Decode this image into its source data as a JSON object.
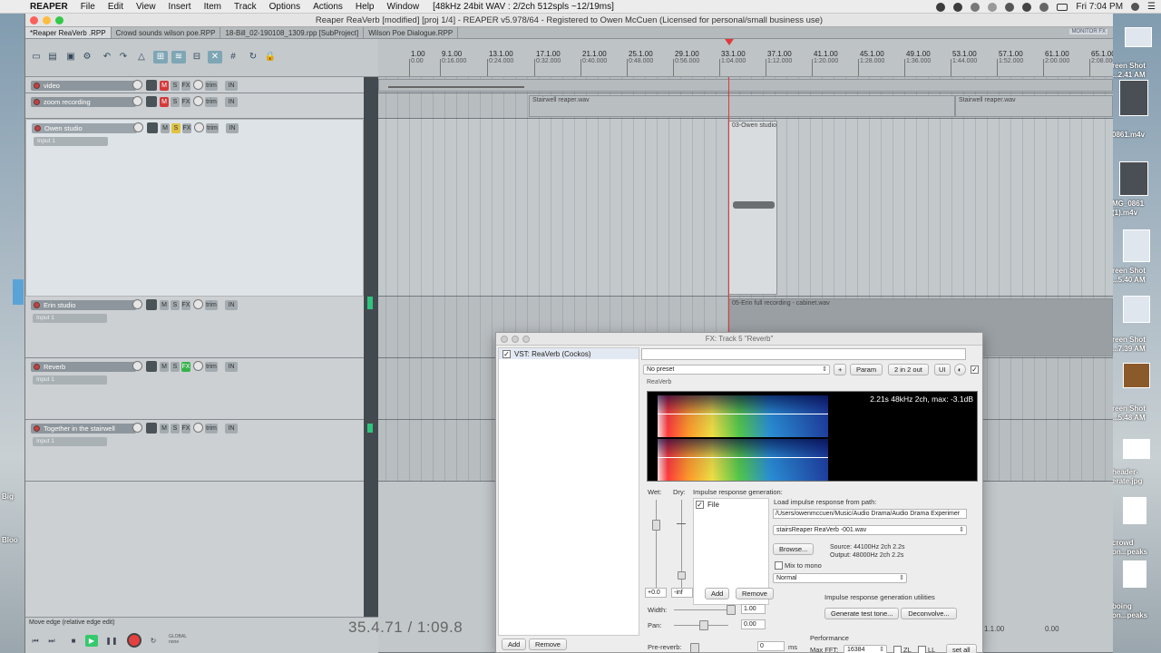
{
  "menubar": {
    "app": "REAPER",
    "items": [
      "File",
      "Edit",
      "View",
      "Insert",
      "Item",
      "Track",
      "Options",
      "Actions",
      "Help",
      "Window"
    ],
    "info": "[48kHz 24bit WAV : 2/2ch 512spls ~12/19ms]",
    "clock": "Fri 7:04 PM"
  },
  "window": {
    "title": "Reaper ReaVerb [modified] [proj 1/4] - REAPER v5.978/64 - Registered to Owen McCuen (Licensed for personal/small business use)",
    "tabs": [
      "*Reaper ReaVerb .RPP",
      "Crowd sounds wilson poe.RPP",
      "18-Bill_02-190108_1309.rpp [SubProject]",
      "Wilson Poe Dialogue.RPP"
    ],
    "monitor_tag": "MONITOR FX"
  },
  "ruler": {
    "ticks": [
      {
        "m": "1.00",
        "s": "0.00"
      },
      {
        "m": "9.1.00",
        "s": "0:16.000"
      },
      {
        "m": "13.1.00",
        "s": "0:24.000"
      },
      {
        "m": "17.1.00",
        "s": "0:32.000"
      },
      {
        "m": "21.1.00",
        "s": "0:40.000"
      },
      {
        "m": "25.1.00",
        "s": "0:48.000"
      },
      {
        "m": "29.1.00",
        "s": "0:56.000"
      },
      {
        "m": "33.1.00",
        "s": "1:04.000"
      },
      {
        "m": "37.1.00",
        "s": "1:12.000"
      },
      {
        "m": "41.1.00",
        "s": "1:20.000"
      },
      {
        "m": "45.1.00",
        "s": "1:28.000"
      },
      {
        "m": "49.1.00",
        "s": "1:36.000"
      },
      {
        "m": "53.1.00",
        "s": "1:44.000"
      },
      {
        "m": "57.1.00",
        "s": "1:52.000"
      },
      {
        "m": "61.1.00",
        "s": "2:00.000"
      },
      {
        "m": "65.1.00",
        "s": "2:08.000"
      }
    ]
  },
  "tracks": [
    {
      "name": "video",
      "input": ""
    },
    {
      "name": "zoom recording",
      "input": ""
    },
    {
      "name": "Owen studio",
      "input": "Input 1"
    },
    {
      "name": "Erin studio",
      "input": "Input 1"
    },
    {
      "name": "Reverb",
      "input": "Input 1"
    },
    {
      "name": "Together in the stairwell",
      "input": "Input 1"
    }
  ],
  "track_buttons": {
    "mute": "M",
    "solo": "S",
    "fx": "FX",
    "io": "trim",
    "rec_mon": "IN"
  },
  "items": {
    "stairwell_a": "Stairwell reaper.wav",
    "stairwell_b": "Stairwell reaper.wav",
    "owen_clip": "03-Owen studio",
    "erin_clip": "05-Erin full recording - cabinet.wav"
  },
  "transport": {
    "status": "Move edge (relative edge edit)",
    "global": "GLOBAL",
    "global_sub": "none",
    "timecode": "35.4.71 / 1:09.8",
    "bpm": "1.1.00",
    "rate": "0.00"
  },
  "fx": {
    "title": "FX: Track 5 \"Reverb\"",
    "plugin": "VST: ReaVerb (Cockos)",
    "preset": "No preset",
    "plus": "+",
    "param": "Param",
    "io": "2 in 2 out",
    "ui": "UI",
    "plugin_name": "ReaVerb",
    "ir_info": "2.21s 48kHz 2ch, max: -3.1dB",
    "wet_label": "Wet:",
    "dry_label": "Dry:",
    "wet_value": "+0.0",
    "dry_value": "-inf",
    "section_title": "Impulse response generation:",
    "file_label": "File",
    "load_label": "Load impulse response from path:",
    "path": "/Users/owenmccuen/Music/Audio Drama/Audio Drama Experimer",
    "file": "stairsReaper ReaVerb -001.wav",
    "browse": "Browse...",
    "source": "Source: 44100Hz 2ch 2.2s",
    "output": "Output: 48000Hz 2ch 2.2s",
    "mix_mono": "Mix to mono",
    "mode": "Normal",
    "add": "Add",
    "remove": "Remove",
    "width_label": "Width:",
    "width_value": "1.00",
    "pan_label": "Pan:",
    "pan_value": "0.00",
    "predelay_label": "Pre-reverb:",
    "predelay_value": "0",
    "predelay_unit": "ms",
    "util_title": "Impulse response generation utilities",
    "gen_test": "Generate test tone...",
    "deconvolve": "Deconvolve...",
    "perf_title": "Performance",
    "maxfft_label": "Max FFT:",
    "maxfft": "16384",
    "zl": "ZL",
    "ll": "LL",
    "set_all": "set all",
    "chain_add": "Add",
    "chain_remove": "Remove"
  },
  "desktop": {
    "items": [
      "reen Shot\n...2.41 AM",
      "0861.m4v",
      "MG_0861\n(1).m4v",
      "reen Shot\n...5.40 AM",
      "reen Shot\n...7.39 AM",
      "reen Shot\n...5.48 AM",
      "header-\nerate.jpg",
      "crowd\non...peaks",
      "boing\non...peaks"
    ],
    "left_labels": [
      "Big",
      "Bloo"
    ]
  }
}
